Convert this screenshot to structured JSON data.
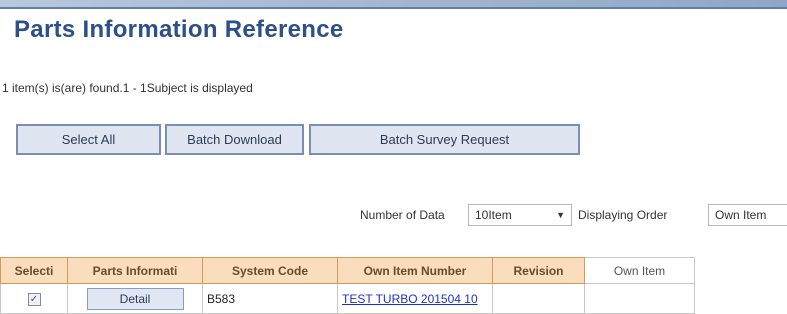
{
  "page": {
    "title": "Parts Information Reference",
    "result_message": "1 item(s) is(are) found.1 - 1Subject is displayed"
  },
  "toolbar": {
    "select_all_label": "Select All",
    "batch_download_label": "Batch Download",
    "batch_survey_label": "Batch Survey Request"
  },
  "options": {
    "number_of_data_label": "Number of Data",
    "number_of_data_value": "10Item",
    "displaying_order_label": "Displaying Order",
    "displaying_order_value": "Own Item"
  },
  "table": {
    "headers": [
      "Selecti",
      "Parts Informati",
      "System Code",
      "Own Item Number",
      "Revision",
      "Own Item"
    ],
    "rows": [
      {
        "checked": "✓",
        "detail_label": "Detail",
        "system_code": "B583",
        "own_item_number": "TEST TURBO 201504 10",
        "revision": "",
        "own_item": ""
      }
    ]
  },
  "colors": {
    "title": "#2d4f8a",
    "button_bg": "#dfe6f2",
    "header_bg": "#f9ddbc",
    "link": "#1d31c9"
  }
}
